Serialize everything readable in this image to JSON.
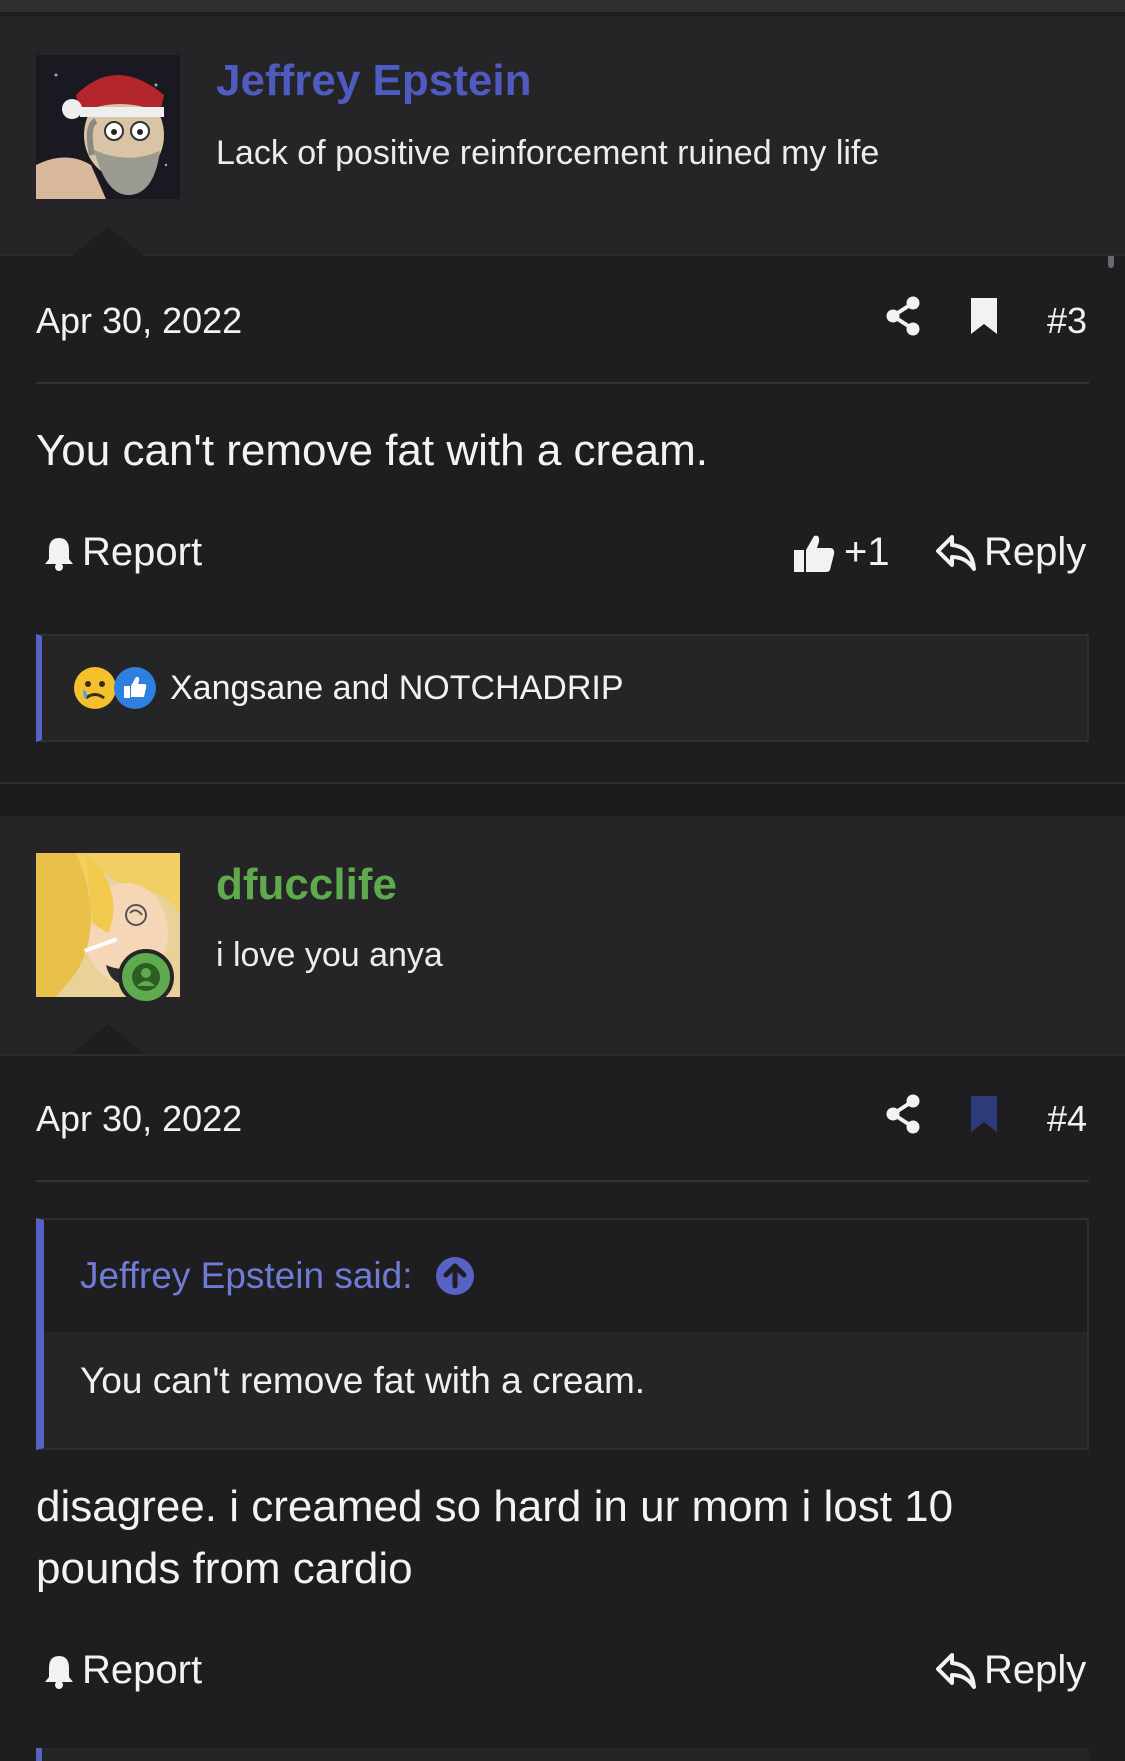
{
  "posts": [
    {
      "username": "Jeffrey Epstein",
      "username_color": "#4f5bc0",
      "user_title": "Lack of positive reinforcement ruined my life",
      "date": "Apr 30, 2022",
      "post_number": "#3",
      "bookmarked": false,
      "content": "You can't remove fat with a cream.",
      "report_label": "Report",
      "like_count": "+1",
      "reply_label": "Reply",
      "reactions_text": "Xangsane and NOTCHADRIP",
      "reaction_icons": [
        "sad-face-icon",
        "thumbs-up-reaction-icon"
      ]
    },
    {
      "username": "dfucclife",
      "username_color": "#5fa94f",
      "user_title": "i love you anya",
      "date": "Apr 30, 2022",
      "post_number": "#4",
      "bookmarked": true,
      "quote": {
        "author_label": "Jeffrey Epstein said:",
        "text": "You can't remove fat with a cream."
      },
      "content": "disagree. i creamed so hard in ur mom i lost 10 pounds from cardio",
      "report_label": "Report",
      "reply_label": "Reply"
    }
  ],
  "colors": {
    "accent": "#5663c4",
    "online_badge": "#5fa94f",
    "bookmark_active": "#2e3a7a"
  }
}
